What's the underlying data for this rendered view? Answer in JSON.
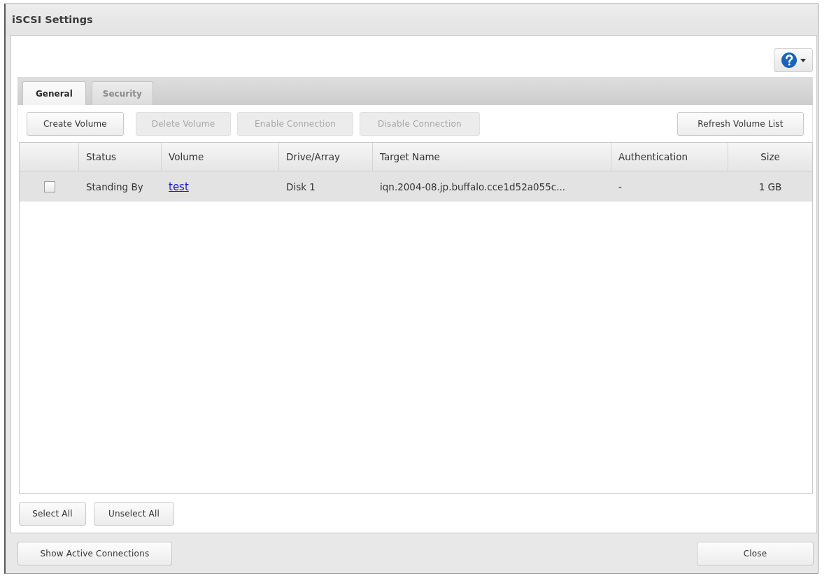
{
  "window": {
    "title": "iSCSI Settings"
  },
  "tabs": [
    {
      "label": "General",
      "selected": true
    },
    {
      "label": "Security",
      "selected": false
    }
  ],
  "toolbar_buttons": [
    {
      "label": "Create Volume",
      "disabled": false
    },
    {
      "label": "Delete Volume",
      "disabled": true
    },
    {
      "label": "Enable Connection",
      "disabled": true
    },
    {
      "label": "Disable Connection",
      "disabled": true
    }
  ],
  "refresh_button": {
    "label": "Refresh Volume List"
  },
  "table": {
    "columns": [
      "Status",
      "Volume",
      "Drive/Array",
      "Target Name",
      "Authentication",
      "Size"
    ],
    "rows": [
      {
        "selected": true,
        "checked": false,
        "status": "Standing By",
        "volume": "test",
        "drive_array": "Disk 1",
        "target_name": "iqn.2004-08.jp.buffalo.cce1d52a055c...",
        "authentication": "-",
        "size": "1 GB"
      }
    ]
  },
  "selection_buttons": [
    "Select All",
    "Unselect All"
  ],
  "footer": {
    "show_connections_button": "Show Active Connections",
    "close_button": "Close"
  }
}
